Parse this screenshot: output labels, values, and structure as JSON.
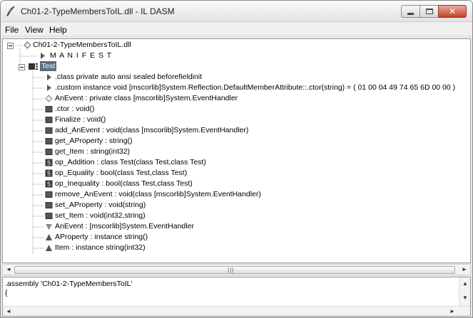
{
  "window": {
    "title": "Ch01-2-TypeMembersToIL.dll - IL DASM"
  },
  "menu": {
    "items": [
      "File",
      "View",
      "Help"
    ]
  },
  "tree": {
    "root": "Ch01-2-TypeMembersToIL.dll",
    "manifest": "M A N I F E S T",
    "class_name": "Test",
    "members": [
      {
        "text": ".class private auto ansi sealed beforefieldinit",
        "icon": "info-triangle"
      },
      {
        "text": ".custom instance void [mscorlib]System.Reflection.DefaultMemberAttribute::.ctor(string) = ( 01 00 04 49 74 65 6D 00 00 )",
        "icon": "info-triangle"
      },
      {
        "text": "AnEvent : private class [mscorlib]System.EventHandler",
        "icon": "field-diamond"
      },
      {
        "text": ".ctor : void()",
        "icon": "method-square"
      },
      {
        "text": "Finalize : void()",
        "icon": "method-square"
      },
      {
        "text": "add_AnEvent : void(class [mscorlib]System.EventHandler)",
        "icon": "method-square"
      },
      {
        "text": "get_AProperty : string()",
        "icon": "method-square"
      },
      {
        "text": "get_Item : string(int32)",
        "icon": "method-square"
      },
      {
        "text": "op_Addition : class Test(class Test,class Test)",
        "icon": "static-method-square"
      },
      {
        "text": "op_Equality : bool(class Test,class Test)",
        "icon": "static-method-square"
      },
      {
        "text": "op_Inequality : bool(class Test,class Test)",
        "icon": "static-method-square"
      },
      {
        "text": "remove_AnEvent : void(class [mscorlib]System.EventHandler)",
        "icon": "method-square"
      },
      {
        "text": "set_AProperty : void(string)",
        "icon": "method-square"
      },
      {
        "text": "set_Item : void(int32,string)",
        "icon": "method-square"
      },
      {
        "text": "AnEvent : [mscorlib]System.EventHandler",
        "icon": "event-triangle-down"
      },
      {
        "text": "AProperty : instance string()",
        "icon": "property-triangle-up"
      },
      {
        "text": "Item : instance string(int32)",
        "icon": "property-triangle-up"
      }
    ]
  },
  "static_badge": "S",
  "code": {
    "lines": [
      ".assembly 'Ch01-2-TypeMembersToIL'",
      "{"
    ]
  },
  "glyphs": {
    "close": "✕",
    "grip": "|||",
    "left": "◄",
    "right": "►",
    "up": "▲",
    "down": "▼"
  },
  "colors": {
    "selection": "#5b6b86",
    "method": "#555555",
    "event": "#8a8a8a"
  }
}
